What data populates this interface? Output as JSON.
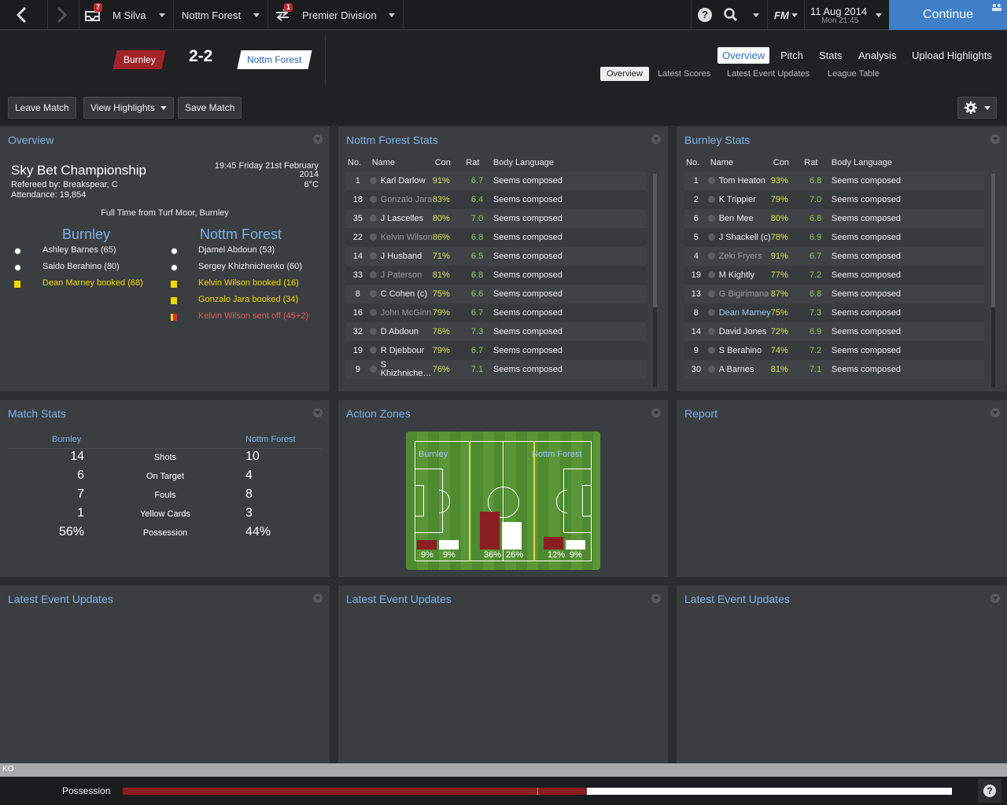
{
  "topbar": {
    "manager": "M Silva",
    "club": "Nottm Forest",
    "competition": "Premier Division",
    "inbox_badge": "7",
    "transfer_badge": "1",
    "fm_label": "FM",
    "date": "11 Aug 2014",
    "time": "Mon 21:45",
    "continue_label": "Continue"
  },
  "match": {
    "home": "Burnley",
    "away": "Nottm Forest",
    "score": "2-2"
  },
  "nav": {
    "tabs": [
      "Overview",
      "Pitch",
      "Stats",
      "Analysis",
      "Upload Highlights"
    ],
    "subtabs": [
      "Overview",
      "Latest Scores",
      "Latest Event Updates",
      "League Table"
    ]
  },
  "actions": {
    "leave": "Leave Match",
    "highlights": "View Highlights",
    "save": "Save Match"
  },
  "overview": {
    "title": "Overview",
    "competition": "Sky Bet Championship",
    "referee": "Refereed by: Breakspear, C",
    "attendance": "Attendance: 19,854",
    "datetime": "19:45 Friday 21st February",
    "year": "2014",
    "temp": "6°C",
    "venue": "Full Time from Turf Moor, Burnley",
    "home_name": "Burnley",
    "away_name": "Nottm Forest",
    "home_events": [
      {
        "type": "goal",
        "text": "Ashley Barnes (65)"
      },
      {
        "type": "goal",
        "text": "Saido Berahino (80)"
      },
      {
        "type": "yellow",
        "text": "Dean Marney booked (68)"
      }
    ],
    "away_events": [
      {
        "type": "goal",
        "text": "Djamel Abdoun (53)"
      },
      {
        "type": "goal",
        "text": "Sergey Khizhnichenko (60)"
      },
      {
        "type": "yellow",
        "text": "Kelvin Wilson booked (16)"
      },
      {
        "type": "yellow",
        "text": "Gonzalo Jara booked (34)"
      },
      {
        "type": "red",
        "text": "Kelvin Wilson sent off (45+2)"
      }
    ]
  },
  "forest_stats": {
    "title": "Nottm Forest Stats",
    "headers": [
      "No.",
      "Name",
      "Con",
      "Rat",
      "Body Language"
    ],
    "rows": [
      {
        "no": "1",
        "name": "Karl Darlow",
        "con": "91%",
        "rat": "6.7",
        "bl": "Seems composed",
        "dim": false
      },
      {
        "no": "18",
        "name": "Gonzalo Jara",
        "con": "83%",
        "rat": "6.4",
        "bl": "Seems composed",
        "dim": true
      },
      {
        "no": "35",
        "name": "J Lascelles",
        "con": "80%",
        "rat": "7.0",
        "bl": "Seems composed",
        "dim": false
      },
      {
        "no": "22",
        "name": "Kelvin Wilson",
        "con": "86%",
        "rat": "6.8",
        "bl": "Seems composed",
        "dim": true
      },
      {
        "no": "14",
        "name": "J Husband",
        "con": "71%",
        "rat": "6.5",
        "bl": "Seems composed",
        "dim": false
      },
      {
        "no": "33",
        "name": "J Paterson",
        "con": "81%",
        "rat": "6.8",
        "bl": "Seems composed",
        "dim": true
      },
      {
        "no": "8",
        "name": "C Cohen (c)",
        "con": "75%",
        "rat": "6.6",
        "bl": "Seems composed",
        "dim": false
      },
      {
        "no": "16",
        "name": "John McGinn",
        "con": "79%",
        "rat": "6.7",
        "bl": "Seems composed",
        "dim": true
      },
      {
        "no": "32",
        "name": "D Abdoun",
        "con": "76%",
        "rat": "7.3",
        "bl": "Seems composed",
        "dim": false
      },
      {
        "no": "19",
        "name": "R Djebbour",
        "con": "79%",
        "rat": "6.7",
        "bl": "Seems composed",
        "dim": false
      },
      {
        "no": "9",
        "name": "S Khizhniche…",
        "con": "76%",
        "rat": "7.1",
        "bl": "Seems composed",
        "dim": false
      }
    ]
  },
  "burnley_stats": {
    "title": "Burnley Stats",
    "headers": [
      "No.",
      "Name",
      "Con",
      "Rat",
      "Body Language"
    ],
    "rows": [
      {
        "no": "1",
        "name": "Tom Heaton",
        "con": "93%",
        "rat": "6.8",
        "bl": "Seems composed",
        "dim": false
      },
      {
        "no": "2",
        "name": "K Trippier",
        "con": "79%",
        "rat": "7.0",
        "bl": "Seems composed",
        "dim": false
      },
      {
        "no": "6",
        "name": "Ben Mee",
        "con": "80%",
        "rat": "6.8",
        "bl": "Seems composed",
        "dim": false
      },
      {
        "no": "5",
        "name": "J Shackell (c)",
        "con": "78%",
        "rat": "6.9",
        "bl": "Seems composed",
        "dim": false
      },
      {
        "no": "4",
        "name": "Zeki Fryers",
        "con": "91%",
        "rat": "6.7",
        "bl": "Seems composed",
        "dim": true
      },
      {
        "no": "19",
        "name": "M Kightly",
        "con": "77%",
        "rat": "7.2",
        "bl": "Seems composed",
        "dim": false
      },
      {
        "no": "13",
        "name": "G Bigirimana",
        "con": "87%",
        "rat": "6.8",
        "bl": "Seems composed",
        "dim": true
      },
      {
        "no": "8",
        "name": "Dean Marney",
        "con": "75%",
        "rat": "7.3",
        "bl": "Seems composed",
        "dim": false,
        "link": true
      },
      {
        "no": "14",
        "name": "David Jones",
        "con": "72%",
        "rat": "6.9",
        "bl": "Seems composed",
        "dim": false
      },
      {
        "no": "9",
        "name": "S Berahino",
        "con": "74%",
        "rat": "7.2",
        "bl": "Seems composed",
        "dim": false
      },
      {
        "no": "30",
        "name": "A Barnes",
        "con": "81%",
        "rat": "7.1",
        "bl": "Seems composed",
        "dim": false
      }
    ]
  },
  "match_stats": {
    "title": "Match Stats",
    "home": "Burnley",
    "away": "Nottm Forest",
    "rows": [
      {
        "label": "Shots",
        "home": "14",
        "away": "10"
      },
      {
        "label": "On Target",
        "home": "6",
        "away": "4"
      },
      {
        "label": "Fouls",
        "home": "7",
        "away": "8"
      },
      {
        "label": "Yellow Cards",
        "home": "1",
        "away": "3"
      },
      {
        "label": "Possession",
        "home": "56%",
        "away": "44%"
      }
    ]
  },
  "action_zones": {
    "title": "Action Zones",
    "home": "Burnley",
    "away": "Nottm Forest",
    "zones": [
      {
        "home": 9,
        "away": 9,
        "home_label": "9%",
        "away_label": "9%"
      },
      {
        "home": 36,
        "away": 26,
        "home_label": "36%",
        "away_label": "26%"
      },
      {
        "home": 12,
        "away": 9,
        "home_label": "12%",
        "away_label": "9%"
      }
    ],
    "home_color": "#8b1e22",
    "away_color": "#ffffff"
  },
  "report": {
    "title": "Report"
  },
  "event_panels": [
    "Latest Event Updates",
    "Latest Event Updates",
    "Latest Event Updates"
  ],
  "bottom": {
    "ko": "KO",
    "possession_label": "Possession",
    "home_possession": 0.56,
    "home_color": "#8b1e22",
    "away_color": "#ffffff"
  }
}
